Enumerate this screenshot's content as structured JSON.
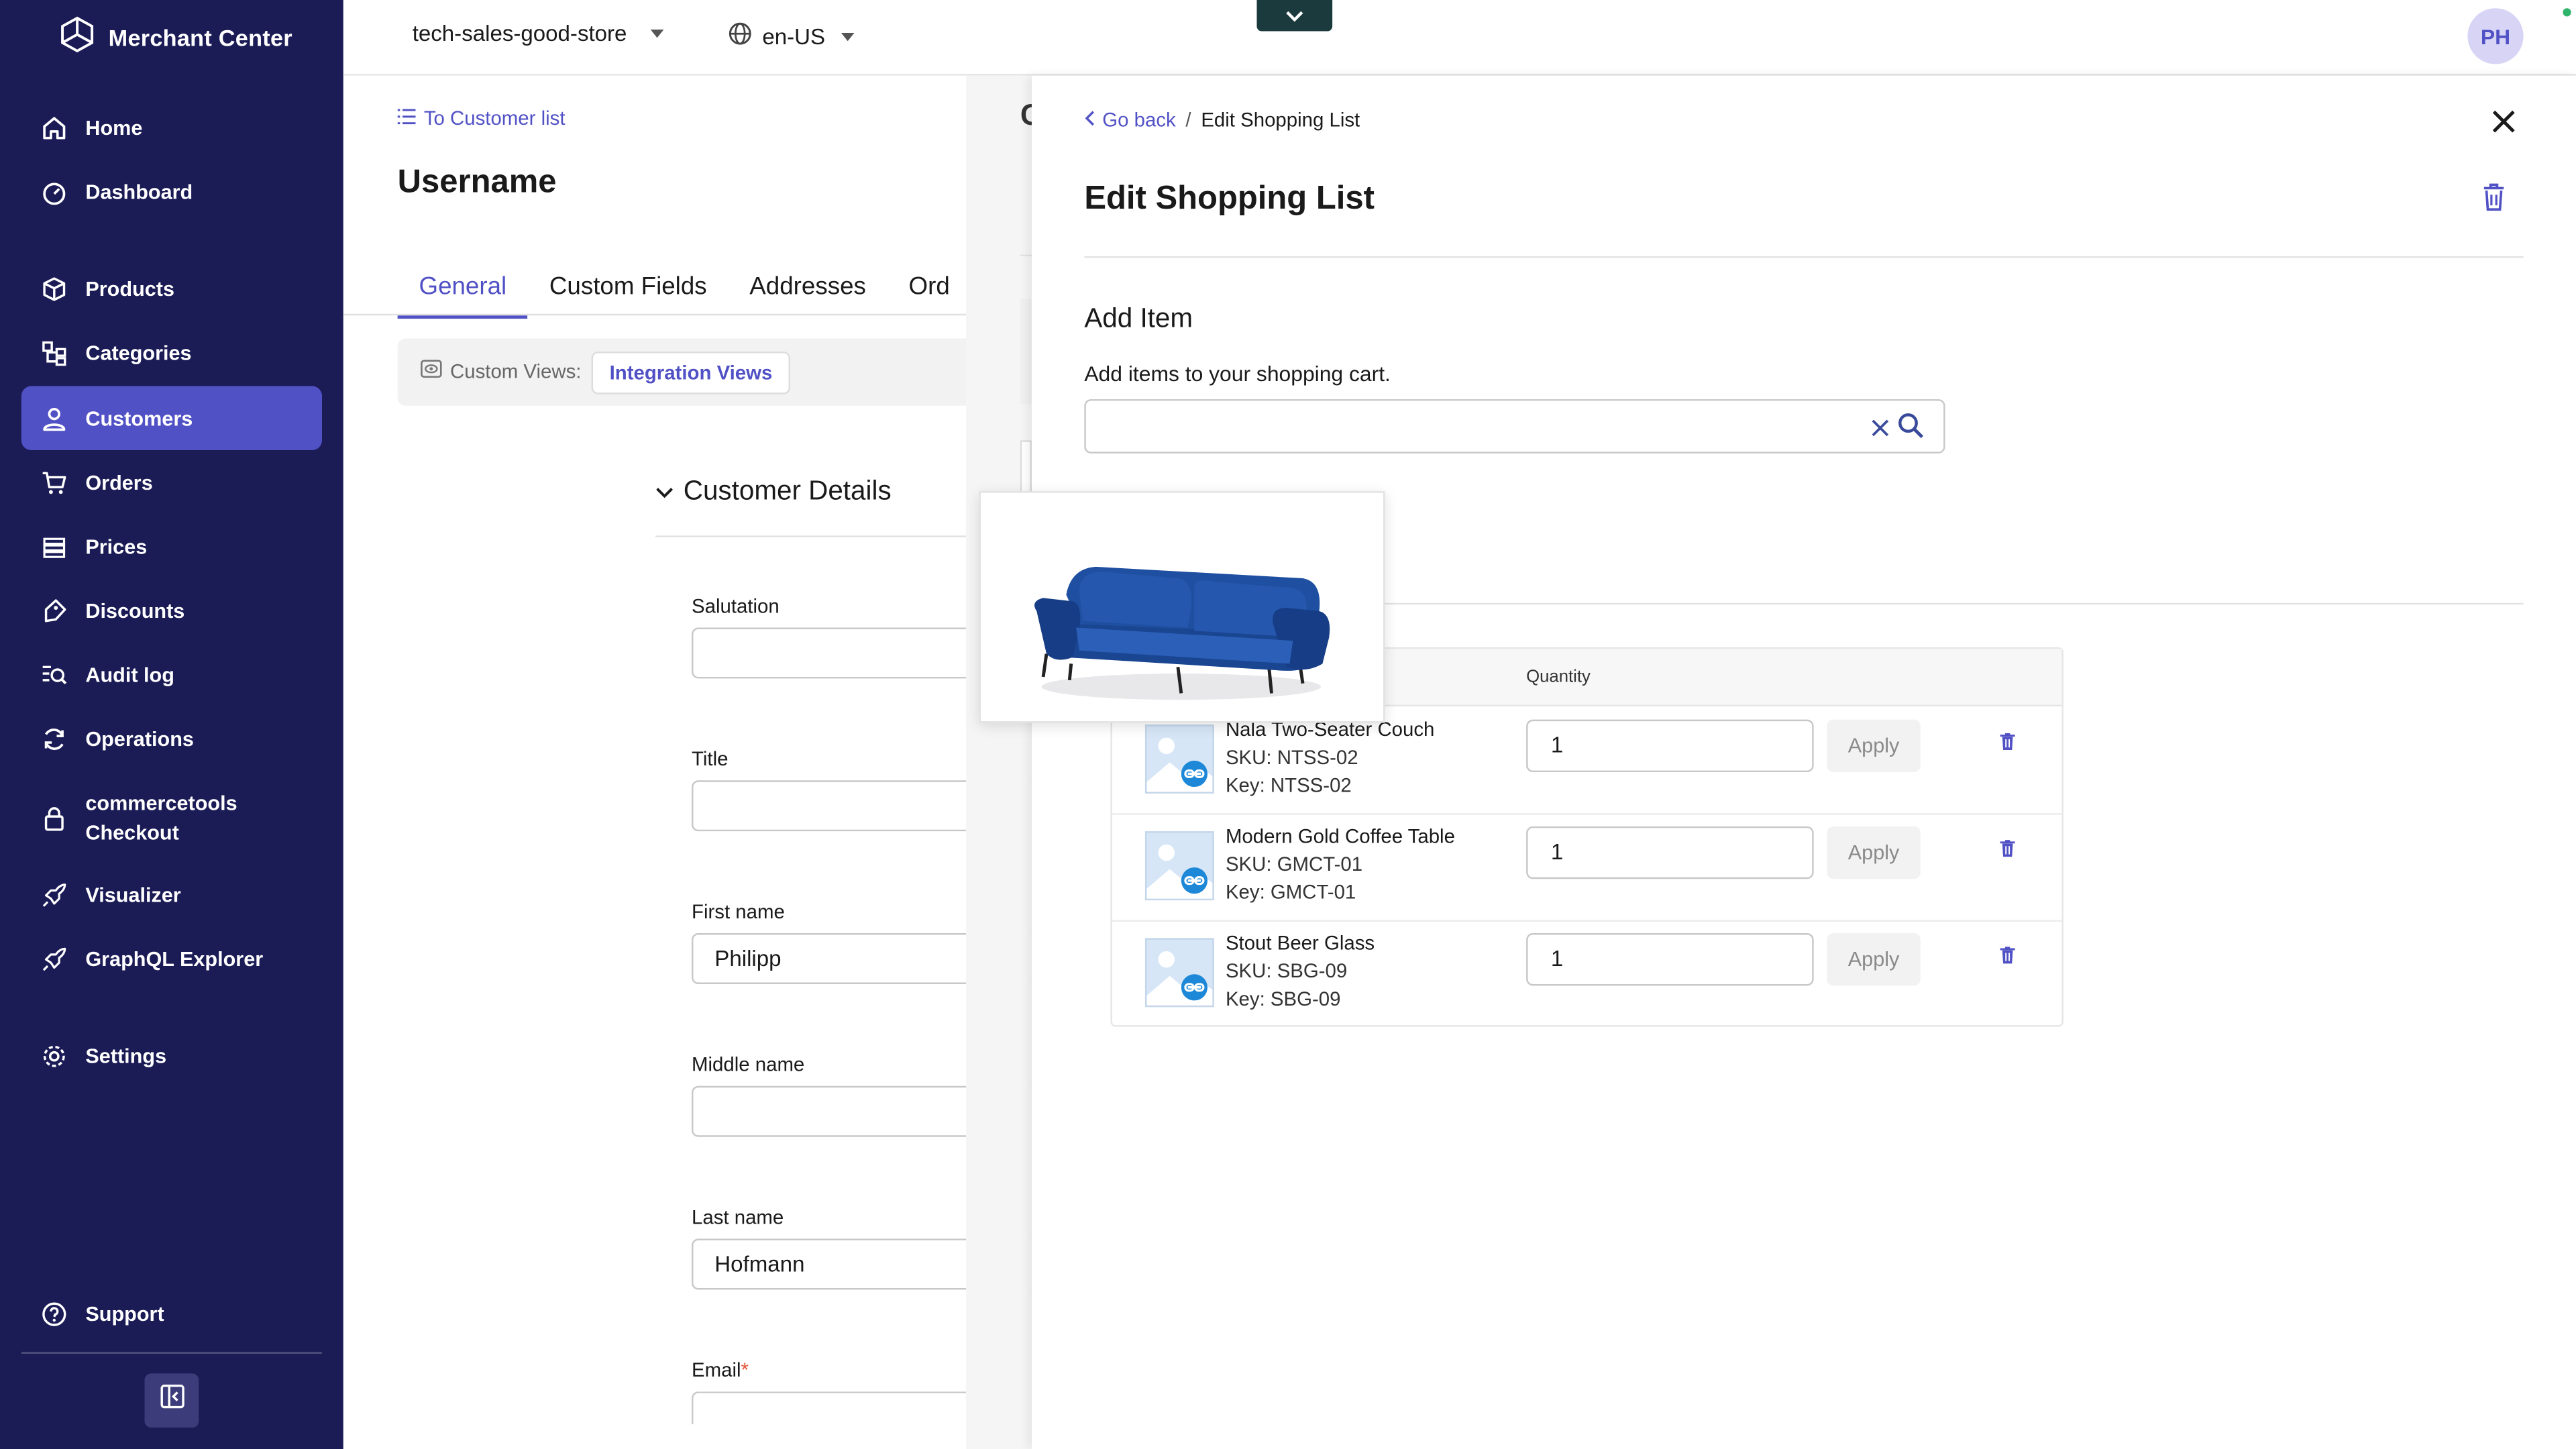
{
  "app": {
    "name": "Merchant Center"
  },
  "sidebar": {
    "items": [
      {
        "label": "Home",
        "icon": "home-icon"
      },
      {
        "label": "Dashboard",
        "icon": "dashboard-icon"
      },
      {
        "label": "Products",
        "icon": "products-icon"
      },
      {
        "label": "Categories",
        "icon": "categories-icon"
      },
      {
        "label": "Customers",
        "icon": "customers-icon",
        "active": true
      },
      {
        "label": "Orders",
        "icon": "cart-icon"
      },
      {
        "label": "Prices",
        "icon": "prices-icon"
      },
      {
        "label": "Discounts",
        "icon": "discounts-icon"
      },
      {
        "label": "Audit log",
        "icon": "audit-log-icon"
      },
      {
        "label": "Operations",
        "icon": "operations-icon"
      },
      {
        "label": "commercetools Checkout",
        "icon": "checkout-lock-icon"
      },
      {
        "label": "Visualizer",
        "icon": "rocket-icon"
      },
      {
        "label": "GraphQL Explorer",
        "icon": "rocket-icon"
      },
      {
        "label": "Settings",
        "icon": "gear-icon"
      },
      {
        "label": "Support",
        "icon": "help-icon"
      }
    ]
  },
  "topbar": {
    "project": "tech-sales-good-store",
    "locale": "en-US",
    "avatar": "PH"
  },
  "customer": {
    "back_link": "To Customer list",
    "title": "Username",
    "tabs": [
      "General",
      "Custom Fields",
      "Addresses",
      "Ord"
    ],
    "views_label": "Custom Views:",
    "views_chip": "Integration Views",
    "section": "Customer Details",
    "fields": {
      "salutation": {
        "label": "Salutation",
        "value": ""
      },
      "title": {
        "label": "Title",
        "value": ""
      },
      "first_name": {
        "label": "First name",
        "value": "Philipp"
      },
      "middle_name": {
        "label": "Middle name",
        "value": ""
      },
      "last_name": {
        "label": "Last name",
        "value": "Hofmann"
      },
      "email": {
        "label": "Email",
        "required_mark": "*"
      }
    },
    "ghost_fragment": "C"
  },
  "panel": {
    "go_back": "Go back",
    "separator": "/",
    "breadcrumb_current": "Edit Shopping List",
    "title": "Edit Shopping List",
    "add_title": "Add Item",
    "add_subtitle": "Add items to your shopping cart.",
    "search": {
      "value": "",
      "placeholder": ""
    },
    "table": {
      "qty_header": "Quantity",
      "apply_label": "Apply",
      "rows": [
        {
          "name": "Nala Two-Seater Couch",
          "sku": "SKU: NTSS-02",
          "key": "Key: NTSS-02",
          "qty": "1"
        },
        {
          "name": "Modern Gold Coffee Table",
          "sku": "SKU: GMCT-01",
          "key": "Key: GMCT-01",
          "qty": "1"
        },
        {
          "name": "Stout Beer Glass",
          "sku": "SKU: SBG-09",
          "key": "Key: SBG-09",
          "qty": "1"
        }
      ]
    }
  },
  "colors": {
    "sidebar_bg": "#1b1b56",
    "accent": "#5151c6",
    "text": "#1a1a1a",
    "couch": "#1f4fa0"
  }
}
